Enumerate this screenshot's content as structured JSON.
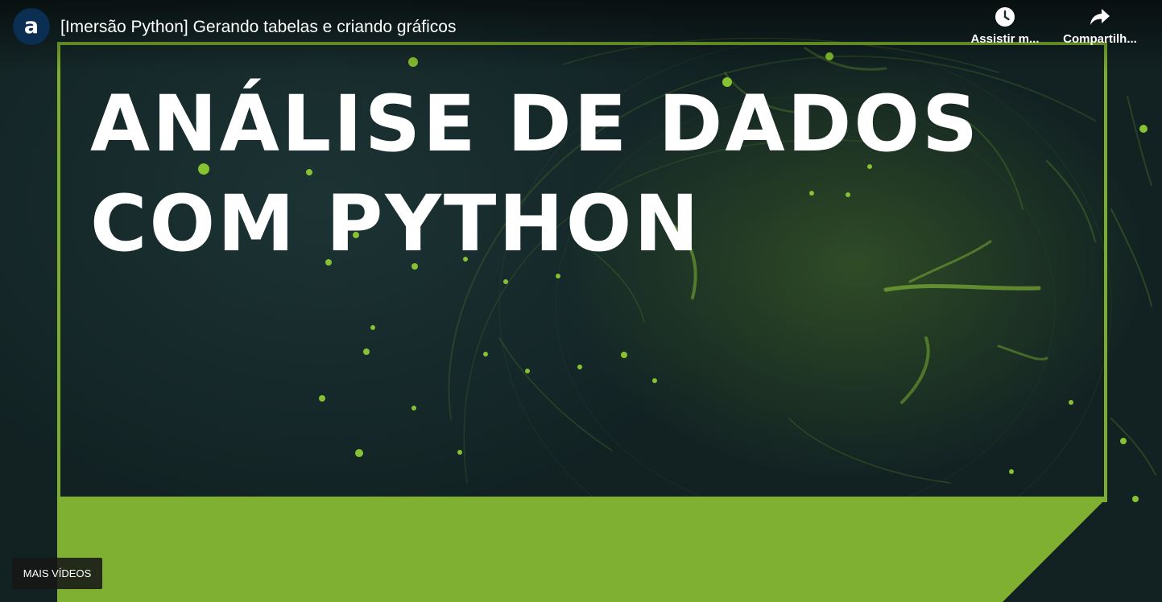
{
  "header": {
    "title": "[Imersão Python] Gerando tabelas e criando gráficos",
    "channel_logo_letter": "a",
    "channel_logo_icon": "channel-logo-icon"
  },
  "actions": {
    "watch_later": {
      "label": "Assistir m...",
      "icon": "clock-icon"
    },
    "share": {
      "label": "Compartilh...",
      "icon": "share-arrow-icon"
    }
  },
  "thumbnail": {
    "headline_line1": "ANÁLISE DE DADOS",
    "headline_line2": "COM PYTHON",
    "accent_color": "#7bae2c",
    "background_color": "#122223"
  },
  "more_videos": {
    "label": "MAIS VÍDEOS"
  }
}
